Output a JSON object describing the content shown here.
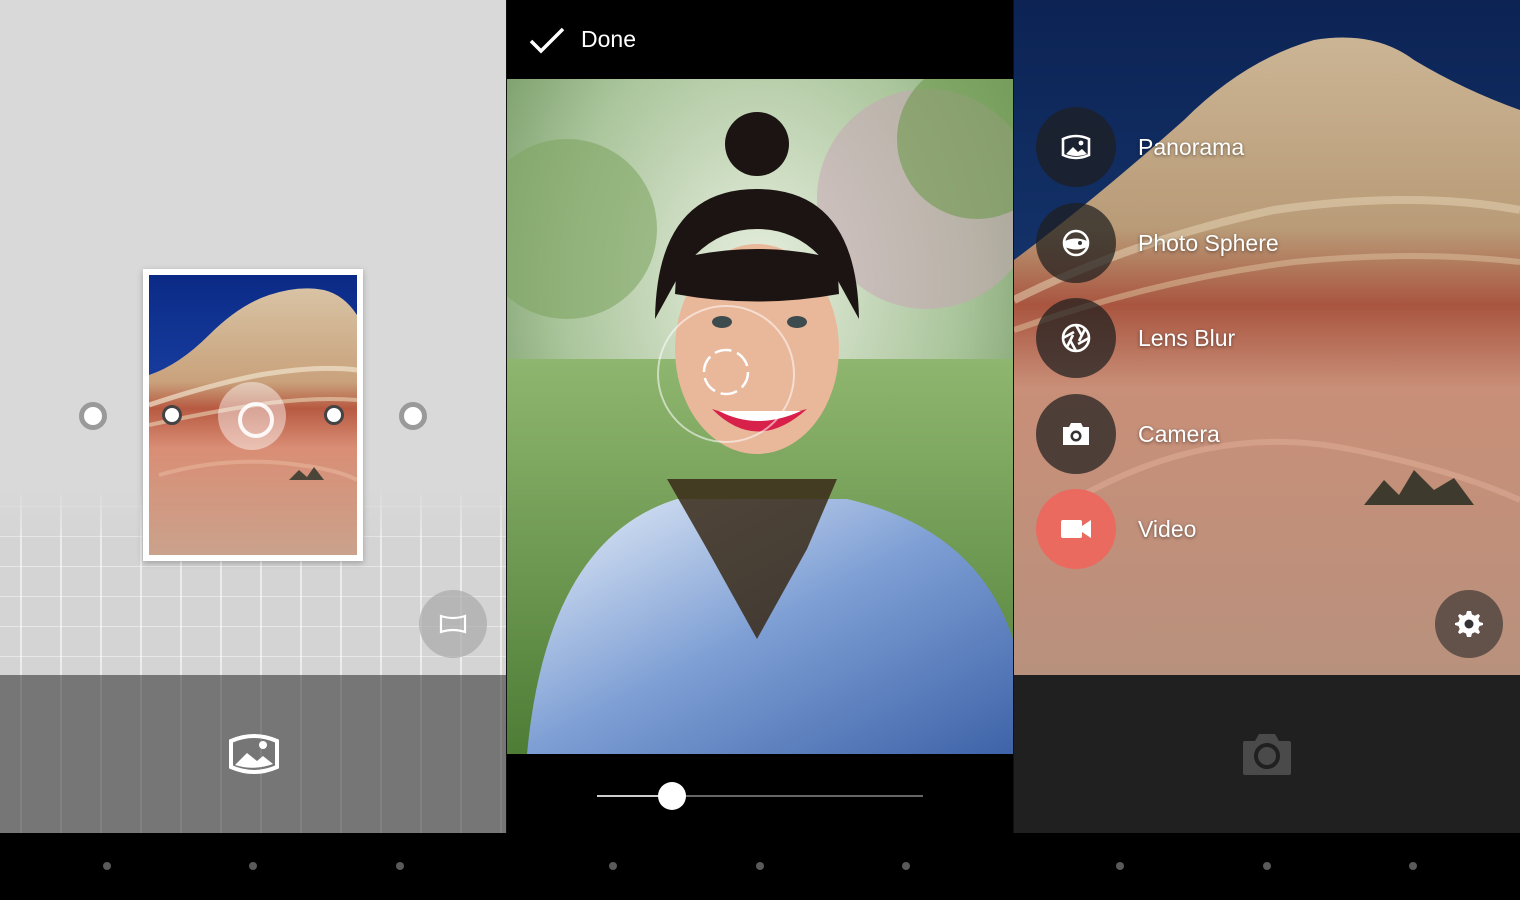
{
  "panel_editor": {
    "done_label": "Done",
    "blur_slider_value": 0.23
  },
  "mode_menu": {
    "items": [
      {
        "label": "Panorama",
        "icon": "panorama-icon"
      },
      {
        "label": "Photo Sphere",
        "icon": "photo-sphere-icon"
      },
      {
        "label": "Lens Blur",
        "icon": "lens-blur-icon"
      },
      {
        "label": "Camera",
        "icon": "camera-icon"
      },
      {
        "label": "Video",
        "icon": "video-icon",
        "active": true
      }
    ]
  },
  "colors": {
    "accent": "#ea6a5f",
    "panel_gray": "#d9d9d9",
    "bottom_gray": "#767676",
    "bottom_dark": "#202020"
  }
}
